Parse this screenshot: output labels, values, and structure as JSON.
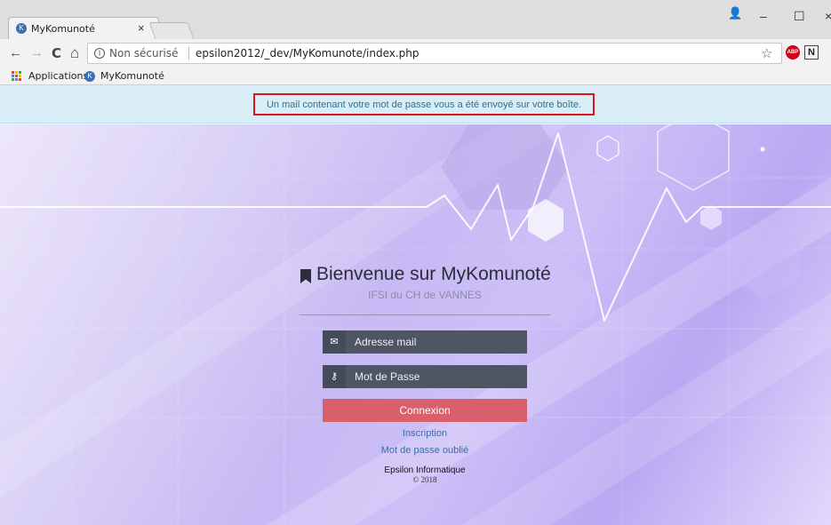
{
  "browser": {
    "tab_title": "MyKomunoté",
    "tab_close": "×",
    "win_account": "👤",
    "win_minimize": "–",
    "win_maximize": "☐",
    "win_close": "×",
    "nav_back": "←",
    "nav_forward": "→",
    "nav_reload": "C",
    "nav_home": "⌂",
    "security_label": "Non sécurisé",
    "url": "epsilon2012/_dev/MyKomunote/index.php",
    "bookmarks": [
      {
        "label": "Applications"
      },
      {
        "label": "MyKomunoté"
      }
    ]
  },
  "alert": {
    "message": "Un mail contenant votre mot de passe vous a été envoyé sur votre boîte."
  },
  "login": {
    "title": "Bienvenue sur MyKomunoté",
    "subtitle": "IFSI du CH de VANNES",
    "email_placeholder": "Adresse mail",
    "password_placeholder": "Mot de Passe",
    "submit_label": "Connexion",
    "register_link": "Inscription",
    "forgot_link": "Mot de passe oublié"
  },
  "footer": {
    "company": "Epsilon Informatique",
    "copyright": "© 2018"
  },
  "colors": {
    "alert_bg": "#d9edf7",
    "alert_text": "#31708f",
    "highlight_border": "#e0141e",
    "field_bg": "#4e5563",
    "button_bg": "#d9606b",
    "link": "#3b6ea8"
  }
}
